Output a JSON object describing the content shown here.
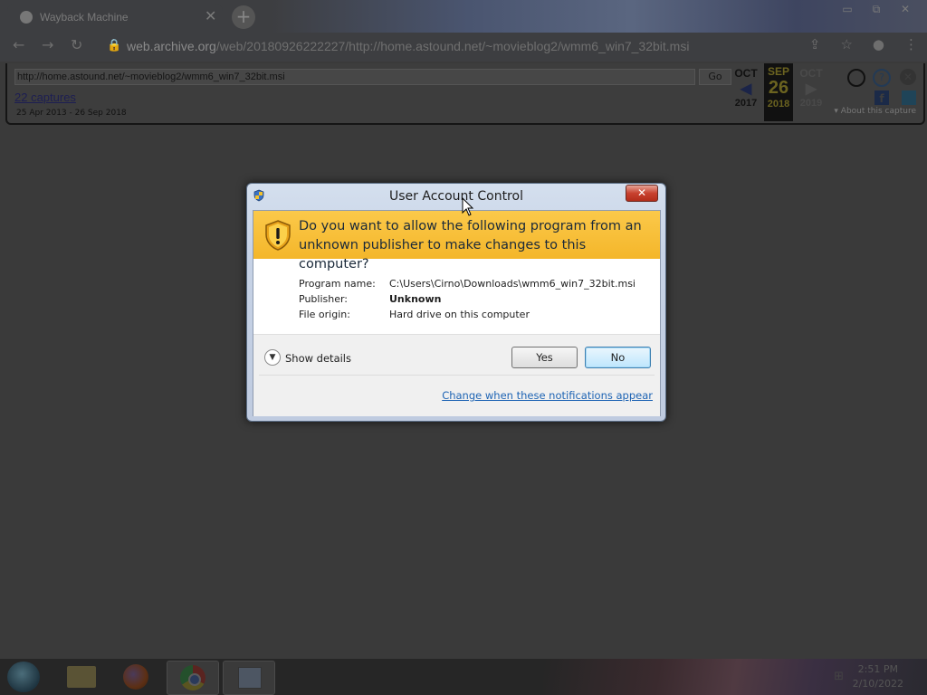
{
  "browser": {
    "tab_title": "Wayback Machine",
    "tab_close": "✕",
    "new_tab": "+",
    "url_host": "web.archive.org",
    "url_path": "/web/20180926222227/http://home.astound.net/~movieblog2/wmm6_win7_32bit.msi",
    "window_buttons": [
      "▭",
      "⧉",
      "✕"
    ]
  },
  "wayback": {
    "url_value": "http://home.astound.net/~movieblog2/wmm6_win7_32bit.msi",
    "go_label": "Go",
    "captures": "22 captures",
    "range": "25 Apr 2013 - 26 Sep 2018",
    "calendar": {
      "prev_month": "OCT",
      "prev_year": "2017",
      "cur_month": "SEP",
      "cur_day": "26",
      "cur_year": "2018",
      "next_month": "OCT",
      "next_year": "2019"
    },
    "about": "▾ About this capture"
  },
  "uac": {
    "title": "User Account Control",
    "close": "✕",
    "question": "Do you want to allow the following program from an unknown publisher to make changes to this computer?",
    "program_label": "Program name:",
    "program_value": "C:\\Users\\Cirno\\Downloads\\wmm6_win7_32bit.msi",
    "publisher_label": "Publisher:",
    "publisher_value": "Unknown",
    "origin_label": "File origin:",
    "origin_value": "Hard drive on this computer",
    "show_details": "Show details",
    "yes": "Yes",
    "no": "No",
    "change_link": "Change when these notifications appear"
  },
  "taskbar": {
    "time": "2:51 PM",
    "date": "2/10/2022"
  },
  "colors": {
    "banner": "#f4b62a",
    "link": "#1e64b4",
    "dim_background": "#3a3a3a"
  }
}
